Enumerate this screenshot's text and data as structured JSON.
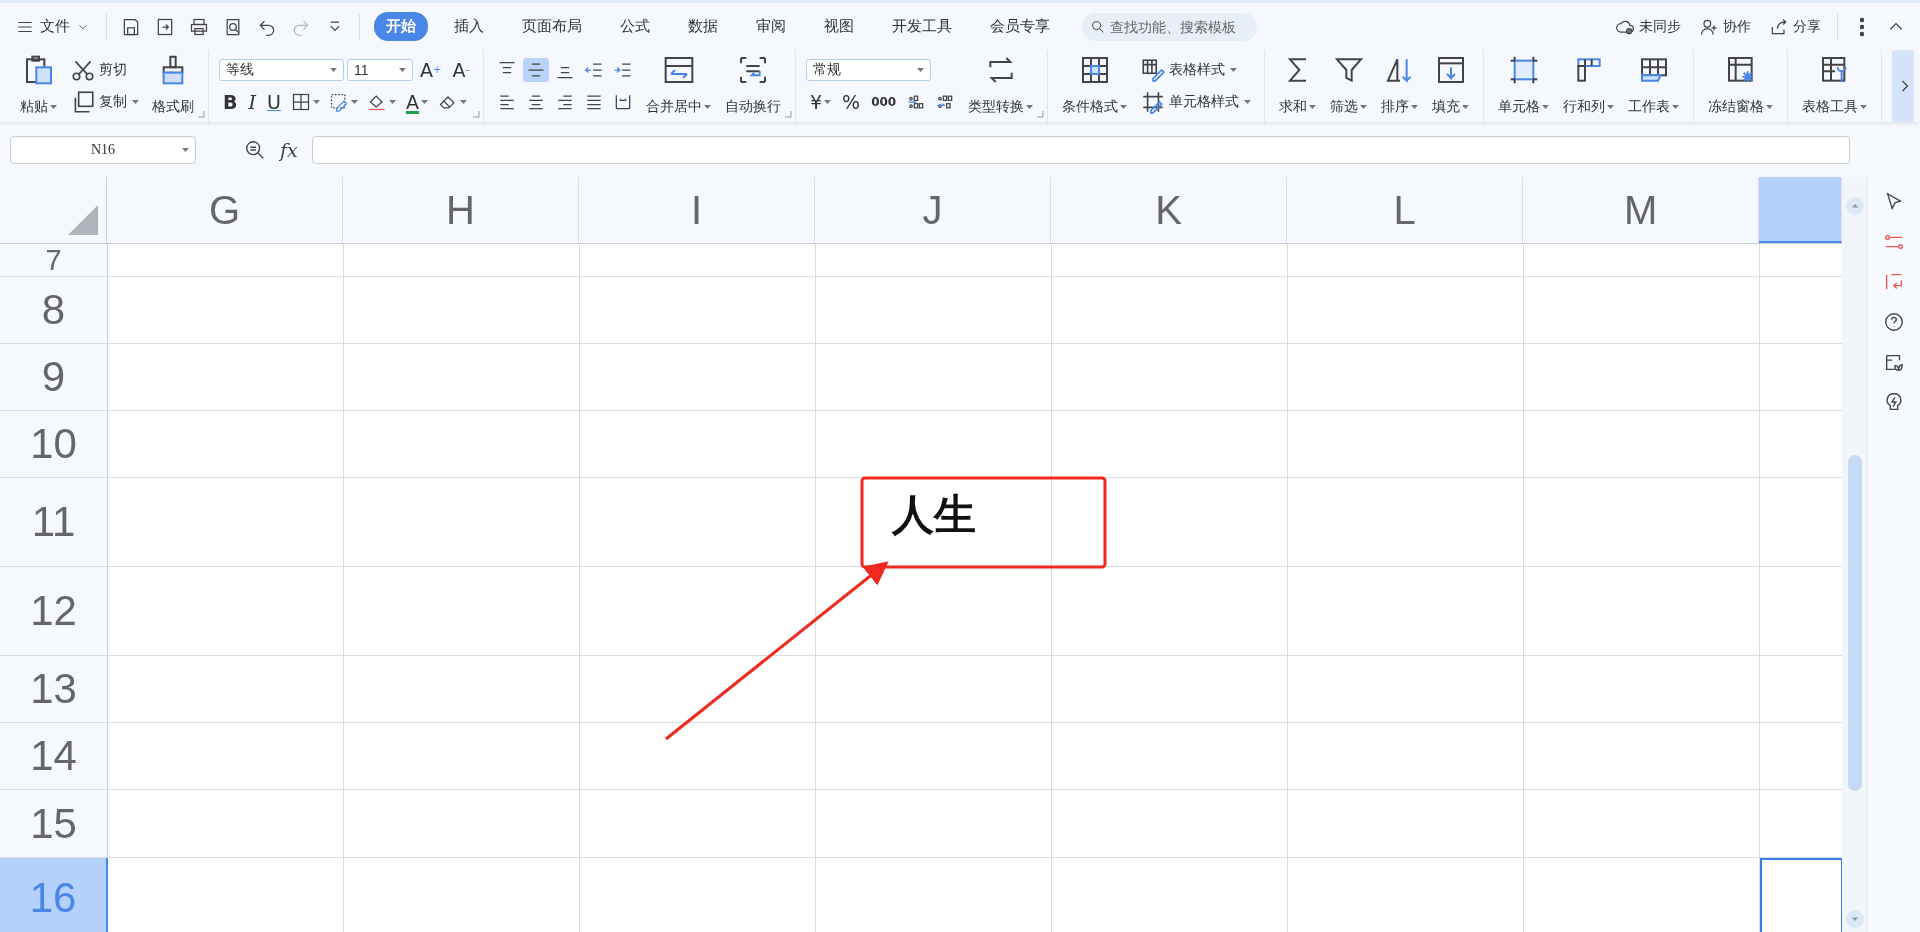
{
  "menu": {
    "label": "文件"
  },
  "quick_actions": [
    {
      "disabled": false
    },
    {
      "disabled": false
    },
    {
      "disabled": false
    },
    {
      "disabled": false
    },
    {
      "disabled": false
    },
    {
      "disabled": true
    },
    {
      "disabled": false
    }
  ],
  "tabs": [
    {
      "label": "开始",
      "selected": true
    },
    {
      "label": "插入",
      "selected": false
    },
    {
      "label": "页面布局",
      "selected": false
    },
    {
      "label": "公式",
      "selected": false
    },
    {
      "label": "数据",
      "selected": false
    },
    {
      "label": "审阅",
      "selected": false
    },
    {
      "label": "视图",
      "selected": false
    },
    {
      "label": "开发工具",
      "selected": false
    },
    {
      "label": "会员专享",
      "selected": false
    }
  ],
  "search": {
    "placeholder": "查找功能、搜索模板"
  },
  "header_actions": [
    {
      "label": "未同步"
    },
    {
      "label": "协作"
    },
    {
      "label": "分享"
    }
  ],
  "ribbon": [
    {
      "launcher": true,
      "columns": [
        {
          "kind": "large",
          "label": "粘贴",
          "dropdown": true
        },
        {
          "kind": "stack",
          "top": [
            {
              "kind": "small",
              "label": "剪切",
              "dropdown": false
            }
          ],
          "bottom": [
            {
              "kind": "small",
              "label": "复制",
              "dropdown": true
            }
          ]
        },
        {
          "kind": "large",
          "label": "格式刷",
          "dropdown": false
        }
      ]
    },
    {
      "launcher": true,
      "columns": [
        {
          "kind": "stack",
          "top": [
            {
              "kind": "select",
              "value": "等线"
            },
            {
              "kind": "select",
              "value": "11"
            },
            {
              "kind": "glyph",
              "label": "A$^{+}$",
              "dropdown": false
            },
            {
              "kind": "glyph",
              "label": "A$^{-}$",
              "dropdown": false
            }
          ],
          "bottom": [
            {
              "kind": "bold",
              "label": "B",
              "dropdown": false
            },
            {
              "kind": "italic",
              "label": "I",
              "dropdown": false
            },
            {
              "kind": "underline",
              "label": "U",
              "dropdown": false
            },
            {
              "kind": "icon",
              "dropdown": true,
              "selected": false
            },
            {
              "kind": "icon",
              "dropdown": true,
              "selected": false
            },
            {
              "kind": "icon",
              "dropdown": true,
              "selected": false
            },
            {
              "kind": "font-color",
              "label": "A",
              "dropdown": true
            },
            {
              "kind": "icon",
              "dropdown": true,
              "selected": false
            }
          ]
        }
      ]
    },
    {
      "launcher": true,
      "columns": [
        {
          "kind": "stack",
          "top": [
            {
              "kind": "icon",
              "dropdown": false,
              "selected": false
            },
            {
              "kind": "icon",
              "dropdown": false,
              "selected": true
            },
            {
              "kind": "icon",
              "dropdown": false,
              "selected": false
            },
            {
              "kind": "icon",
              "dropdown": false,
              "selected": false
            },
            {
              "kind": "icon",
              "dropdown": false,
              "selected": false
            }
          ],
          "bottom": [
            {
              "kind": "icon",
              "dropdown": false,
              "selected": false
            },
            {
              "kind": "icon",
              "dropdown": false,
              "selected": false
            },
            {
              "kind": "icon",
              "dropdown": false,
              "selected": false
            },
            {
              "kind": "icon",
              "dropdown": false,
              "selected": false
            },
            {
              "kind": "icon",
              "dropdown": false,
              "selected": false
            }
          ]
        },
        {
          "kind": "large",
          "label": "合并居中",
          "dropdown": true
        },
        {
          "kind": "large",
          "label": "自动换行",
          "dropdown": false
        }
      ]
    },
    {
      "launcher": true,
      "columns": [
        {
          "kind": "stack",
          "top": [
            {
              "kind": "select",
              "value": "常规"
            }
          ],
          "bottom": [
            {
              "kind": "glyph",
              "label": "¥",
              "dropdown": true
            },
            {
              "kind": "glyph",
              "label": "%",
              "dropdown": false
            },
            {
              "kind": "small-glyph",
              "label": "000",
              "dropdown": false
            },
            {
              "kind": "icon",
              "dropdown": false,
              "selected": false
            },
            {
              "kind": "icon",
              "dropdown": false,
              "selected": false
            }
          ]
        },
        {
          "kind": "large",
          "label": "类型转换",
          "dropdown": true
        }
      ]
    },
    {
      "columns": [
        {
          "kind": "large",
          "label": "条件格式",
          "dropdown": true
        },
        {
          "kind": "stack",
          "top": [
            {
              "kind": "small",
              "label": "表格样式",
              "dropdown": true
            }
          ],
          "bottom": [
            {
              "kind": "small",
              "label": "单元格样式",
              "dropdown": true
            }
          ]
        }
      ]
    },
    {
      "columns": [
        {
          "kind": "large",
          "label": "求和",
          "dropdown": true
        },
        {
          "kind": "large",
          "label": "筛选",
          "dropdown": true
        },
        {
          "kind": "large",
          "label": "排序",
          "dropdown": true
        },
        {
          "kind": "large",
          "label": "填充",
          "dropdown": true
        }
      ]
    },
    {
      "columns": [
        {
          "kind": "large",
          "label": "单元格",
          "dropdown": true
        },
        {
          "kind": "large",
          "label": "行和列",
          "dropdown": true
        },
        {
          "kind": "large",
          "label": "工作表",
          "dropdown": true
        }
      ]
    },
    {
      "columns": [
        {
          "kind": "large",
          "label": "冻结窗格",
          "dropdown": true
        }
      ]
    },
    {
      "columns": [
        {
          "kind": "large",
          "label": "表格工具",
          "dropdown": true
        }
      ]
    }
  ],
  "formula_bar": {
    "name_box": "N16",
    "fx_label": "fx"
  },
  "columns": [
    {
      "label": "G",
      "selected": false
    },
    {
      "label": "H",
      "selected": false
    },
    {
      "label": "I",
      "selected": false
    },
    {
      "label": "J",
      "selected": false
    },
    {
      "label": "K",
      "selected": false
    },
    {
      "label": "L",
      "selected": false
    },
    {
      "label": "M",
      "selected": false
    },
    {
      "selected": true
    }
  ],
  "rows": [
    {
      "label": "7",
      "selected": false,
      "cells": []
    },
    {
      "label": "8",
      "selected": false,
      "cells": []
    },
    {
      "label": "9",
      "selected": false,
      "cells": []
    },
    {
      "label": "10",
      "selected": false,
      "cells": []
    },
    {
      "label": "11",
      "selected": false,
      "cells": [
        null,
        null,
        null,
        "人生"
      ]
    },
    {
      "label": "12",
      "selected": false,
      "cells": []
    },
    {
      "label": "13",
      "selected": false,
      "cells": []
    },
    {
      "label": "14",
      "selected": false,
      "cells": []
    },
    {
      "label": "15",
      "selected": false,
      "cells": []
    },
    {
      "label": "16",
      "selected": true,
      "cells": []
    }
  ]
}
